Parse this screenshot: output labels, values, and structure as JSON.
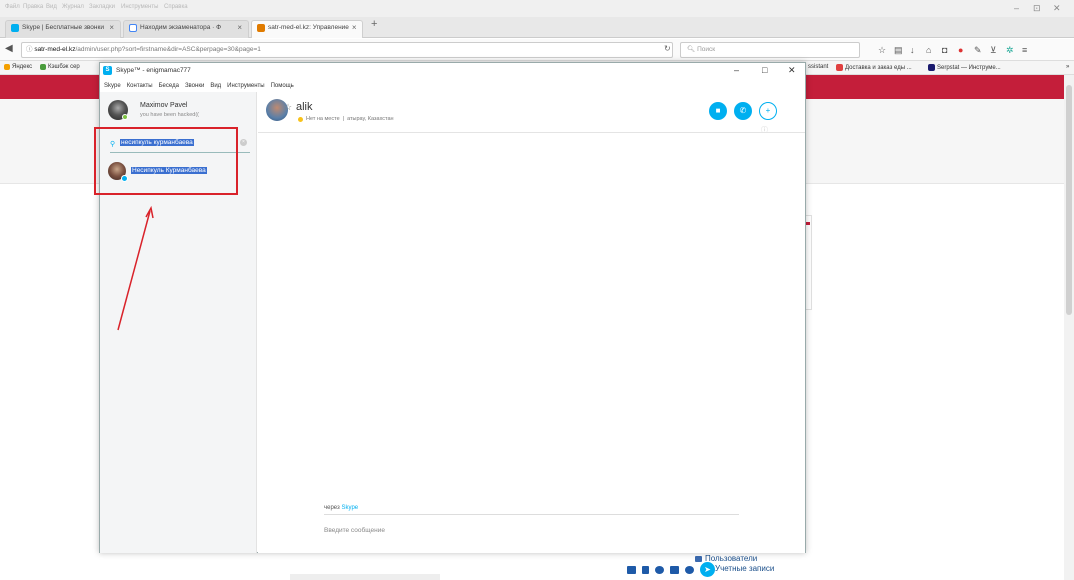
{
  "firefox": {
    "menu": [
      "Файл",
      "Правка",
      "Вид",
      "Журнал",
      "Закладки",
      "Инструменты",
      "Справка"
    ],
    "window_controls": [
      "–",
      "⊡",
      "✕"
    ],
    "tabs": [
      {
        "title": "Skype | Бесплатные звонки",
        "favicon_color": "#00aff0"
      },
      {
        "title": "Находим экзаменатора · Ф",
        "favicon_color": "#4285f4"
      },
      {
        "title": "satr-med-el.kz: Управление",
        "favicon_color": "#e07b00"
      }
    ],
    "new_tab_symbol": "+",
    "url_host": "satr-med-el.kz",
    "url_path": "/admin/user.php?sort=firstname&dir=ASC&perpage=30&page=1",
    "search_placeholder": "Поиск",
    "bookmarks_left": [
      {
        "label": "Яндекс",
        "color": "#f4a000"
      },
      {
        "label": "Кэшбэк сер",
        "color": "#4a9c3c"
      }
    ],
    "bookmarks_right": [
      {
        "label": "ssistant",
        "color": ""
      },
      {
        "label": "Доставка и заказ еды ...",
        "color": "#e04040"
      },
      {
        "label": "Serpstat — Инструме...",
        "color": "#1a1a6e"
      }
    ],
    "bookmarks_more": "»"
  },
  "page": {
    "sidebar_links": [
      {
        "label": "Пользователи"
      },
      {
        "label": "Учетные записи"
      }
    ]
  },
  "skype": {
    "window_title": "Skype™ - enigmamac777",
    "logo_letter": "S",
    "window_controls": [
      "–",
      "□",
      "✕"
    ],
    "menu": [
      "Skype",
      "Контакты",
      "Беседа",
      "Звонки",
      "Вид",
      "Инструменты",
      "Помощь"
    ],
    "profile": {
      "name": "Maximov Pavel",
      "mood": "you have been hacked(("
    },
    "search": {
      "value": "несипкуль курманбаева"
    },
    "search_result": {
      "name": "Несипкуль Курманбаева"
    },
    "chat": {
      "contact_name": "alik",
      "status": "Нет на месте",
      "location": "атырау, Казахстан",
      "via_label": "через",
      "via_link": "Skype",
      "message_placeholder": "Введите сообщение"
    },
    "colors": {
      "accent": "#00aff0",
      "annotation": "#d9222a",
      "highlight": "#3a6fd0"
    }
  }
}
